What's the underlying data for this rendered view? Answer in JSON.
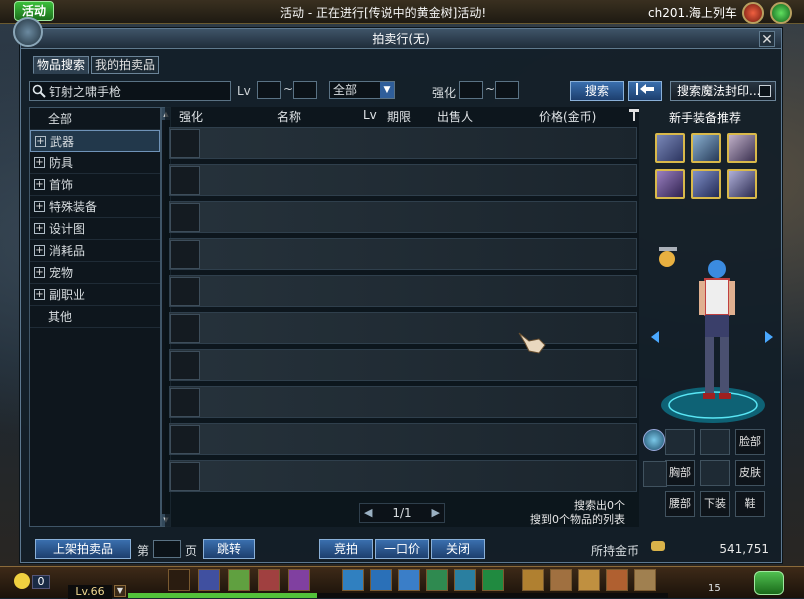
{
  "topbar": {
    "event_button": "活动",
    "event_text": "活动 - 正在进行[传说中的黄金树]活动!",
    "server_text": "ch201.海上列车"
  },
  "window": {
    "title": "拍卖行(无)",
    "close": "✕",
    "tabs": [
      {
        "label": "物品搜索",
        "active": true
      },
      {
        "label": "我的拍卖品",
        "active": false
      }
    ]
  },
  "search": {
    "query": "钉射之啸手枪",
    "lv_label": "Lv",
    "tilde": "~",
    "category_value": "全部",
    "enhance_label": "强化",
    "search_button": "搜索",
    "magic_seal_button": "搜索魔法封印..."
  },
  "categories": [
    {
      "label": "全部",
      "plus": false,
      "selected": false
    },
    {
      "label": "武器",
      "plus": true,
      "selected": true
    },
    {
      "label": "防具",
      "plus": true,
      "selected": false
    },
    {
      "label": "首饰",
      "plus": true,
      "selected": false
    },
    {
      "label": "特殊装备",
      "plus": true,
      "selected": false
    },
    {
      "label": "设计图",
      "plus": true,
      "selected": false
    },
    {
      "label": "消耗品",
      "plus": true,
      "selected": false
    },
    {
      "label": "宠物",
      "plus": true,
      "selected": false
    },
    {
      "label": "副职业",
      "plus": true,
      "selected": false
    },
    {
      "label": "其他",
      "plus": false,
      "selected": false
    }
  ],
  "results": {
    "headers": {
      "enhance": "强化",
      "name": "名称",
      "lv": "Lv",
      "period": "期限",
      "seller": "出售人",
      "price": "价格(金币)"
    },
    "page": "1/1",
    "found_text": "搜索出0个",
    "list_text": "搜到0个物品的列表"
  },
  "right_panel": {
    "recommend_title": "新手装备推荐",
    "equip_labels": [
      "脸部",
      "胸部",
      "皮肤",
      "腰部",
      "下装",
      "鞋"
    ]
  },
  "bottom": {
    "list_item_button": "上架拍卖品",
    "page_label": "第",
    "page_unit": "页",
    "jump_button": "跳转",
    "bid_button": "竞拍",
    "buyout_button": "一口价",
    "close_button": "关闭",
    "gold_label": "所持金币",
    "gold_value": "541,751"
  },
  "hotbar": {
    "level": "Lv.66",
    "coin_count": "0",
    "fatigue": "15",
    "exp_fraction": 0.35
  }
}
